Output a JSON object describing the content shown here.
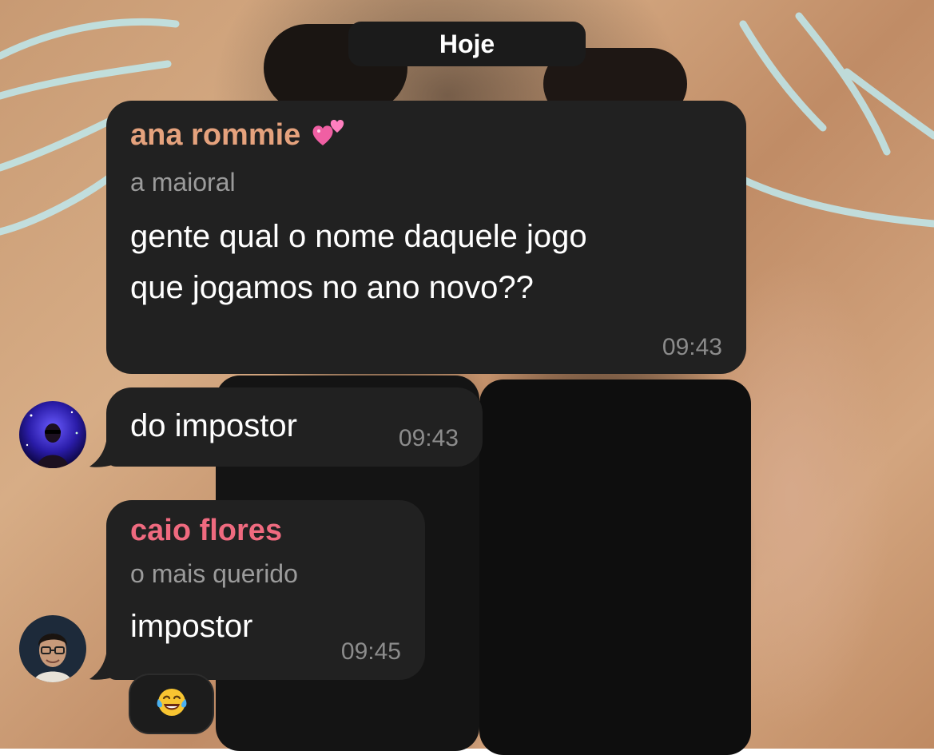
{
  "chat": {
    "date_label": "Hoje",
    "messages": [
      {
        "sender": "ana rommie",
        "sender_emoji": "two-hearts-emoji",
        "sender_color": "#e5a27d",
        "title": "a maioral",
        "text_lines": [
          "gente qual o nome daquele jogo",
          "que jogamos no ano novo??"
        ],
        "time": "09:43"
      },
      {
        "text": "do impostor",
        "time": "09:43",
        "avatar": "purple-galaxy-avatar"
      },
      {
        "sender": "caio flores",
        "sender_color": "#ef6a7f",
        "title": "o mais querido",
        "text": "impostor",
        "time": "09:45",
        "avatar": "man-with-glasses-avatar",
        "reaction": "face-with-tears-of-joy-emoji"
      }
    ]
  },
  "colors": {
    "bubble_bg": "#212121",
    "time_text": "#8c8c8c",
    "title_text": "#9b9b9b"
  }
}
